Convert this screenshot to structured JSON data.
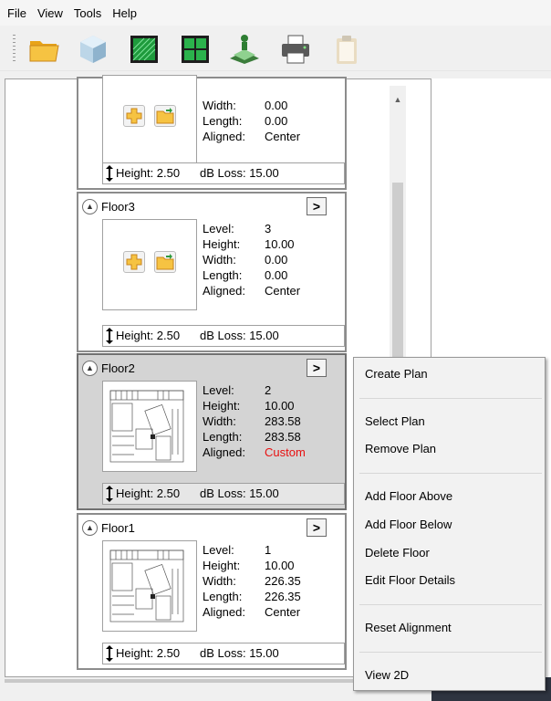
{
  "menu": [
    "File",
    "View",
    "Tools",
    "Help"
  ],
  "toolbar": {
    "icons": [
      "open-folder-icon",
      "3d-cube-icon",
      "plan-icon",
      "grid-icon",
      "layer-icon",
      "print-icon",
      "clipboard-icon"
    ]
  },
  "floors": [
    {
      "name": "",
      "props": [
        {
          "k": "Width:",
          "v": "0.00"
        },
        {
          "k": "Length:",
          "v": "0.00"
        },
        {
          "k": "Aligned:",
          "v": "Center"
        }
      ],
      "footer_height": "Height: 2.50",
      "footer_db": "dB Loss: 15.00",
      "thumb": "buttons"
    },
    {
      "name": "Floor3",
      "props": [
        {
          "k": "Level:",
          "v": "3"
        },
        {
          "k": "Height:",
          "v": "10.00"
        },
        {
          "k": "Width:",
          "v": "0.00"
        },
        {
          "k": "Length:",
          "v": "0.00"
        },
        {
          "k": "Aligned:",
          "v": "Center"
        }
      ],
      "footer_height": "Height: 2.50",
      "footer_db": "dB Loss: 15.00",
      "thumb": "buttons"
    },
    {
      "name": "Floor2",
      "props": [
        {
          "k": "Level:",
          "v": "2"
        },
        {
          "k": "Height:",
          "v": "10.00"
        },
        {
          "k": "Width:",
          "v": "283.58"
        },
        {
          "k": "Length:",
          "v": "283.58"
        },
        {
          "k": "Aligned:",
          "v": "Custom"
        }
      ],
      "footer_height": "Height: 2.50",
      "footer_db": "dB Loss: 15.00",
      "thumb": "plan"
    },
    {
      "name": "Floor1",
      "props": [
        {
          "k": "Level:",
          "v": "1"
        },
        {
          "k": "Height:",
          "v": "10.00"
        },
        {
          "k": "Width:",
          "v": "226.35"
        },
        {
          "k": "Length:",
          "v": "226.35"
        },
        {
          "k": "Aligned:",
          "v": "Center"
        }
      ],
      "footer_height": "Height: 2.50",
      "footer_db": "dB Loss: 15.00",
      "thumb": "plan"
    }
  ],
  "context_menu": {
    "create_plan": "Create Plan",
    "select_plan": "Select Plan",
    "remove_plan": "Remove Plan",
    "add_floor_above": "Add Floor Above",
    "add_floor_below": "Add Floor Below",
    "delete_floor": "Delete Floor",
    "edit_floor_details": "Edit Floor Details",
    "reset_alignment": "Reset Alignment",
    "view_2d": "View 2D"
  },
  "colors": {
    "custom_alignment": "#e81010",
    "selected_card": "#d4d4d4"
  }
}
